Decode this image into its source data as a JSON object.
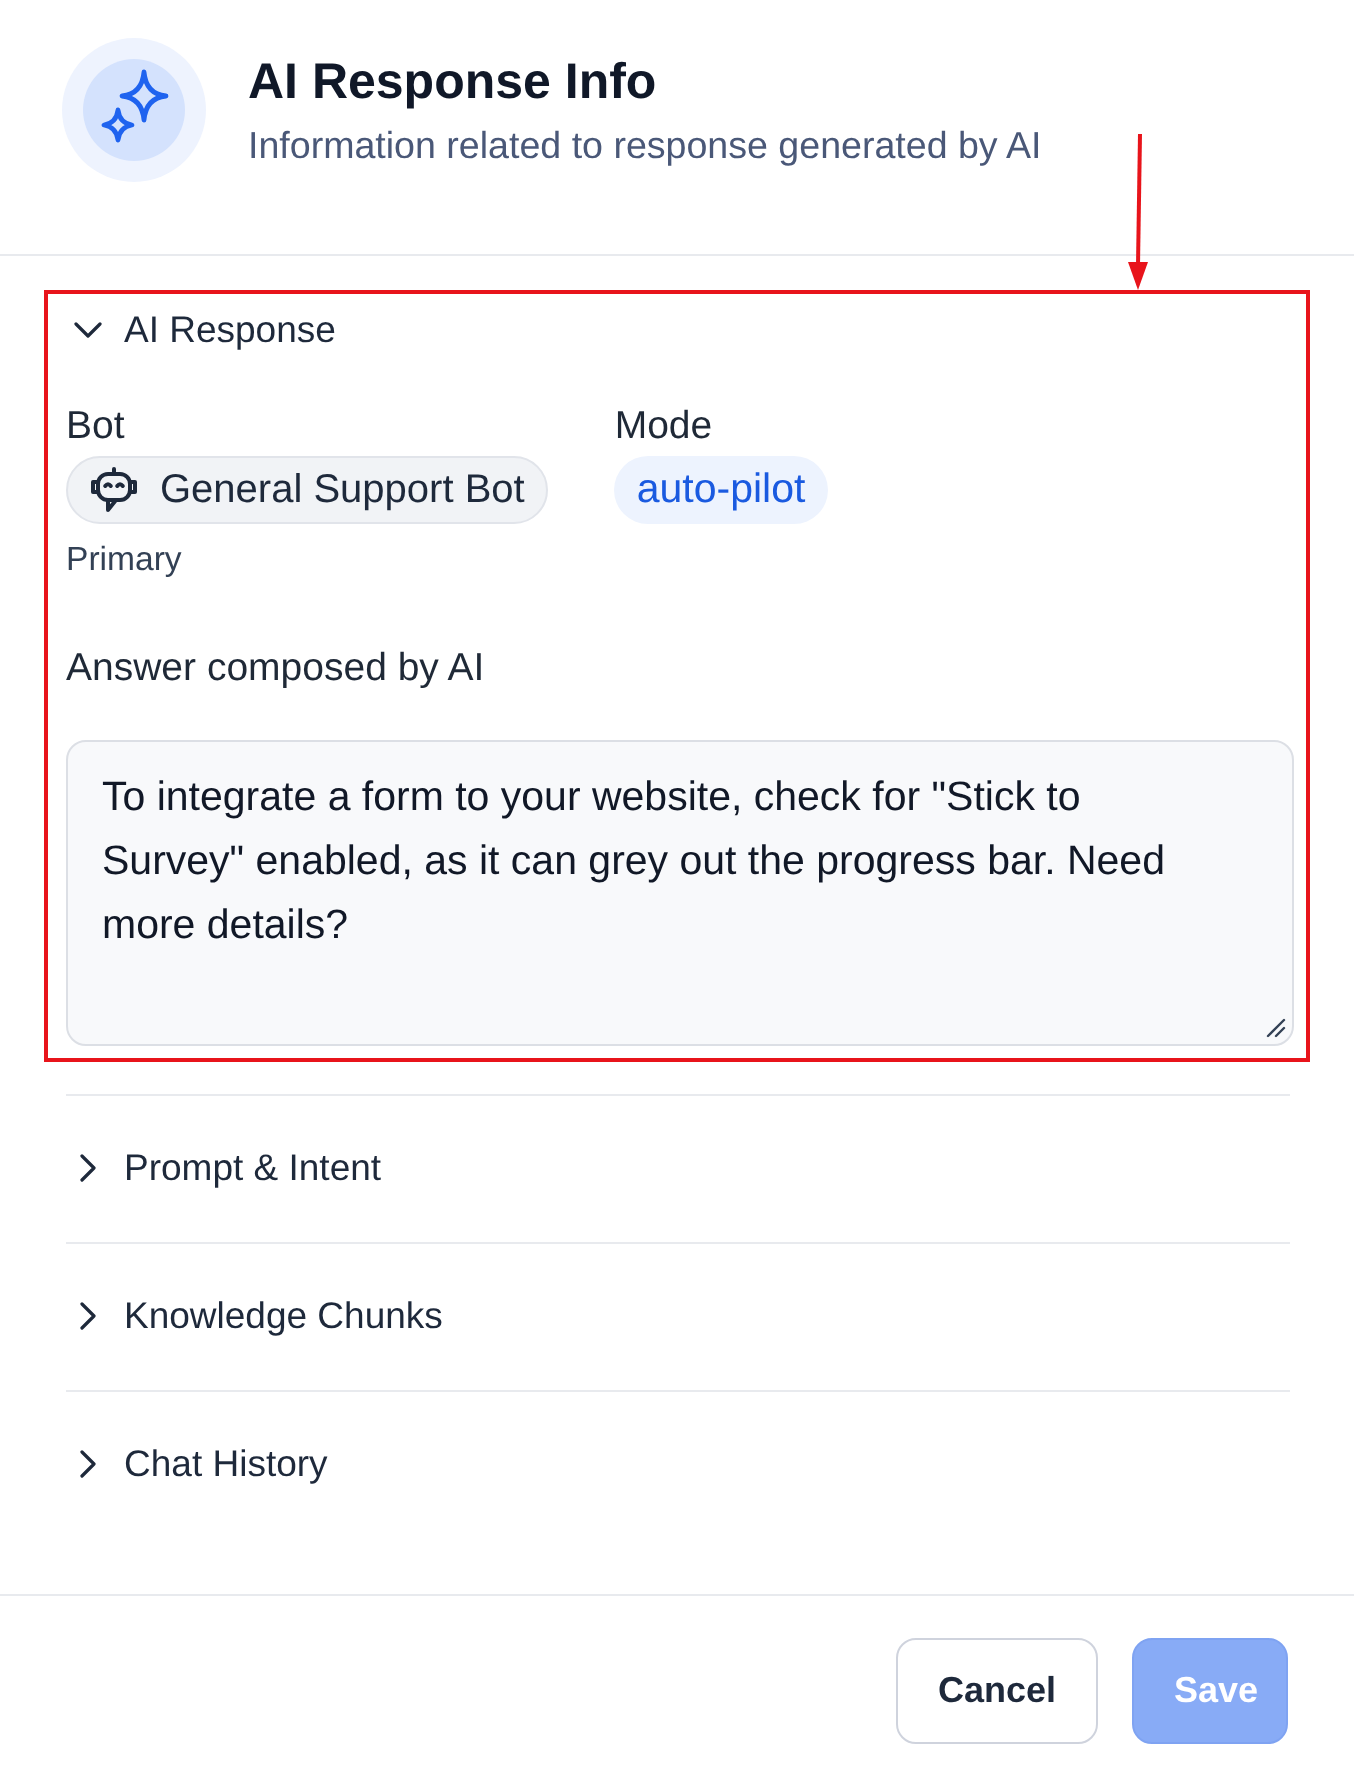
{
  "header": {
    "title": "AI Response Info",
    "subtitle": "Information related to response generated by AI"
  },
  "sections": [
    {
      "title": "AI Response",
      "expanded": true,
      "highlighted": true,
      "content": {
        "bot": {
          "label": "Bot",
          "name": "General Support Bot",
          "role": "Primary"
        },
        "mode": {
          "label": "Mode",
          "value": "auto-pilot"
        },
        "answer": {
          "label": "Answer composed by AI",
          "value": "To integrate a form to your website, check for \"Stick to Survey\" enabled, as it can grey out the progress bar. Need more details?"
        }
      }
    },
    {
      "title": "Prompt & Intent",
      "expanded": false,
      "highlighted": false
    },
    {
      "title": "Knowledge Chunks",
      "expanded": false,
      "highlighted": false
    },
    {
      "title": "Chat History",
      "expanded": false,
      "highlighted": false
    }
  ],
  "buttons": [
    {
      "label": "Cancel",
      "kind": "secondary",
      "disabled": false
    },
    {
      "label": "Save",
      "kind": "primary",
      "disabled": true
    }
  ]
}
